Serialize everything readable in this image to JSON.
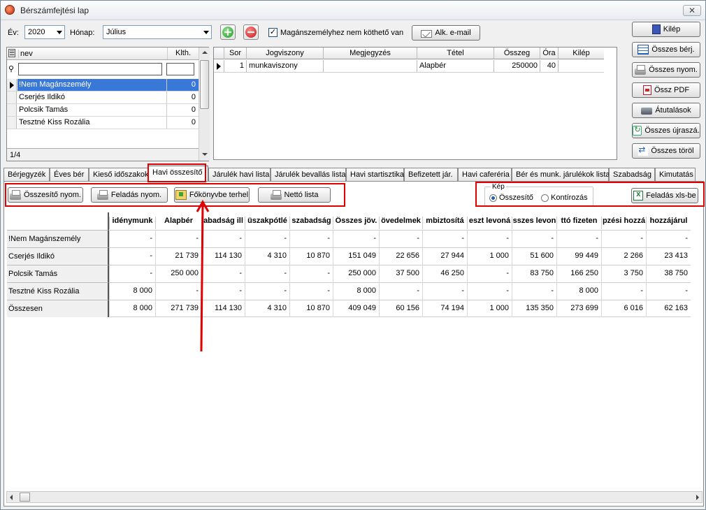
{
  "window": {
    "title": "Bérszámfejtési lap",
    "close": "✕"
  },
  "toolbar": {
    "year_label": "Év:",
    "year_value": "2020",
    "month_label": "Hónap:",
    "month_value": "Július",
    "checkbox_label": "Magánszemélyhez nem köthető van",
    "checkbox_checked": true,
    "email_button": "Alk. e-mail"
  },
  "side_buttons": [
    {
      "label": "Kilép",
      "icon": "door-icon"
    },
    {
      "label": "Összes bérj.",
      "icon": "table-icon"
    },
    {
      "label": "Összes nyom.",
      "icon": "printer-icon"
    },
    {
      "label": "Össz PDF",
      "icon": "pdf-icon"
    },
    {
      "label": "Átutalások",
      "icon": "transfer-icon"
    },
    {
      "label": "Összes újraszá.",
      "icon": "refresh-icon"
    },
    {
      "label": "Összes töröl",
      "icon": "delete-all-icon"
    }
  ],
  "employees": {
    "headers": {
      "name": "nev",
      "klth": "Klth."
    },
    "rows": [
      {
        "name": "!Nem Magánszemély",
        "klth": "0",
        "selected": true
      },
      {
        "name": "Cserjés Ildikó",
        "klth": "0"
      },
      {
        "name": "Polcsik Tamás",
        "klth": "0"
      },
      {
        "name": "Teszt­né Kiss Rozália",
        "klth": "0"
      }
    ],
    "status": "1/4"
  },
  "items": {
    "headers": [
      "Sor",
      "Jogviszony",
      "Megjegyzés",
      "Tétel",
      "Összeg",
      "Óra",
      "Kilép"
    ],
    "rows": [
      {
        "sor": "1",
        "jogviszony": "munkaviszony",
        "megjegyzes": "",
        "tetel": "Alapbér",
        "osszeg": "250000",
        "ora": "40",
        "kilep": ""
      }
    ]
  },
  "tabs": [
    {
      "label": "Bérjegyzék"
    },
    {
      "label": "Éves bér"
    },
    {
      "label": "Kieső időszakok"
    },
    {
      "label": "Havi összesítő",
      "active": true
    },
    {
      "label": "Járulék havi lista"
    },
    {
      "label": "Járulék bevallás lista"
    },
    {
      "label": "Havi startisztika"
    },
    {
      "label": "Befizetett jár."
    },
    {
      "label": "Havi caferéria"
    },
    {
      "label": "Bér és munk. járulékok lista"
    },
    {
      "label": "Szabadság"
    },
    {
      "label": "Kimutatás"
    }
  ],
  "summary_toolbar": {
    "buttons": [
      "Összesítő nyom.",
      "Feladás nyom.",
      "Főkönyvbe terhel",
      "Nettó lista"
    ],
    "group_label": "Kép",
    "radio_options": [
      "Összesítő",
      "Kontírozás"
    ],
    "export_button": "Feladás xls-be"
  },
  "summary": {
    "headers": [
      "idénymunk",
      "Alapbér",
      "abadság ill",
      "üszakpótlé",
      "szabadság",
      "Összes jöv.",
      "övedelmek",
      "mbiztosítá",
      "eszt levoná",
      "sszes levon",
      "ttó fizeten",
      "pzési hozzá",
      "hozzájárul"
    ],
    "rows": [
      {
        "name": "!Nem Magánszemély",
        "values": [
          "-",
          "-",
          "-",
          "-",
          "-",
          "-",
          "-",
          "-",
          "-",
          "-",
          "-",
          "-",
          "-"
        ]
      },
      {
        "name": "Cserjés Ildikó",
        "values": [
          "-",
          "21 739",
          "114 130",
          "4 310",
          "10 870",
          "151 049",
          "22 656",
          "27 944",
          "1 000",
          "51 600",
          "99 449",
          "2 266",
          "23 413"
        ]
      },
      {
        "name": "Polcsik Tamás",
        "values": [
          "-",
          "250 000",
          "-",
          "-",
          "-",
          "250 000",
          "37 500",
          "46 250",
          "-",
          "83 750",
          "166 250",
          "3 750",
          "38 750"
        ]
      },
      {
        "name": "Teszt­né Kiss Rozália",
        "values": [
          "8 000",
          "-",
          "-",
          "-",
          "-",
          "8 000",
          "-",
          "-",
          "-",
          "-",
          "8 000",
          "-",
          "-"
        ]
      },
      {
        "name": "Összesen",
        "values": [
          "8 000",
          "271 739",
          "114 130",
          "4 310",
          "10 870",
          "409 049",
          "60 156",
          "74 194",
          "1 000",
          "135 350",
          "273 699",
          "6 016",
          "62 163"
        ]
      }
    ]
  },
  "colors": {
    "annotation_red": "#e00000",
    "selection_blue": "#3a78d8"
  }
}
